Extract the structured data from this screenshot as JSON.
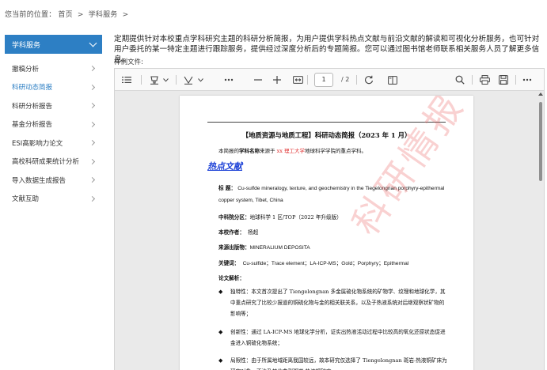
{
  "breadcrumb": {
    "prefix": "您当前的位置：",
    "home": "首页",
    "sep1": ">",
    "section": "学科服务",
    "sep2": ">"
  },
  "sidebar": {
    "header": "学科服务",
    "items": [
      {
        "label": "撤稿分析"
      },
      {
        "label": "科研动态简报"
      },
      {
        "label": "科研分析报告"
      },
      {
        "label": "基金分析报告"
      },
      {
        "label": "ESI高影响力论文"
      },
      {
        "label": "高校科研成果统计分析"
      },
      {
        "label": "导入数据生成报告"
      },
      {
        "label": "文献互助"
      }
    ]
  },
  "main": {
    "description": "定期提供针对本校重点学科研究主题的科研分析简报，为用户提供学科热点文献与前沿文献的解读和可视化分析服务，也可针对用户委托的某一特定主题进行跟踪服务，提供经过深度分析后的专题简报。您可以通过图书馆老师联系相关服务人员了解更多信息。",
    "sample_label": "样例文件:"
  },
  "viewer": {
    "page_current": "1",
    "page_total": "/ 2",
    "icons": [
      "list-icon",
      "highlight-icon",
      "chevron-down-icon",
      "draw-icon",
      "chevron-down-icon",
      "more-icon",
      "zoom-out-icon",
      "zoom-in-icon",
      "fit-page-icon",
      "rotate-icon",
      "page-view-icon",
      "search-icon",
      "print-icon",
      "save-icon",
      "more-icon"
    ]
  },
  "document": {
    "title": "【地质资源与地质工程】科研动态简报（2023 年 1 月）",
    "intro_pre": "本简报的",
    "intro_bold": "学科名称",
    "intro_mid": "来源于 ",
    "intro_red": "xx 理工大学",
    "intro_post": "地球科学学院的重点学科。",
    "section_heading": "热点文献",
    "title_label": "标 题：",
    "title_value": "Cu-sulfde mineralogy, texture, and geochemistry in the Tiegelongnan porphyry-epithermal copper system, Tibet, China",
    "category_label": "中科院分区：",
    "category_value": "地球科学 1 区/TOP（2022 年升级版）",
    "author_label": "本校作者：",
    "author_value": "杨超",
    "journal_label": "来源出版物：",
    "journal_value": "MINERALIUM DEPOSITA",
    "keywords_label": "关键词：",
    "keywords_value": "Cu-sulfide；Trace element；LA-ICP-MS；Gold；Porphyry；Epithermal",
    "analysis_label": "论文解析：",
    "bullets": [
      "独特性：本文首次提出了 Tiengelongnan 多金属硫化物系统的矿物学、纹理和地球化学，其中重点研究了比较少报道的铜硫化物与金的相关联关系，以及子热液系统对后继观察状矿物的影响等；",
      "创新性：通过 LA-ICP-MS 地球化学分析，证实出热液活动过程中比较高的氧化还原状态促进金进入铜硫化物系统；",
      "局限性：由于所属地域距离我国较远，故本研究仅选择了 Tiengelongnan 斑岩-热液铜矿床为研究对象，不涉及其他典型斑岩-热液铜矿床。"
    ],
    "watermark": "科研情报"
  },
  "colors": {
    "accent": "#2d7fc4",
    "link_red": "#e03030",
    "heading_blue": "#1a3fd6",
    "watermark": "#eb5a5a"
  }
}
